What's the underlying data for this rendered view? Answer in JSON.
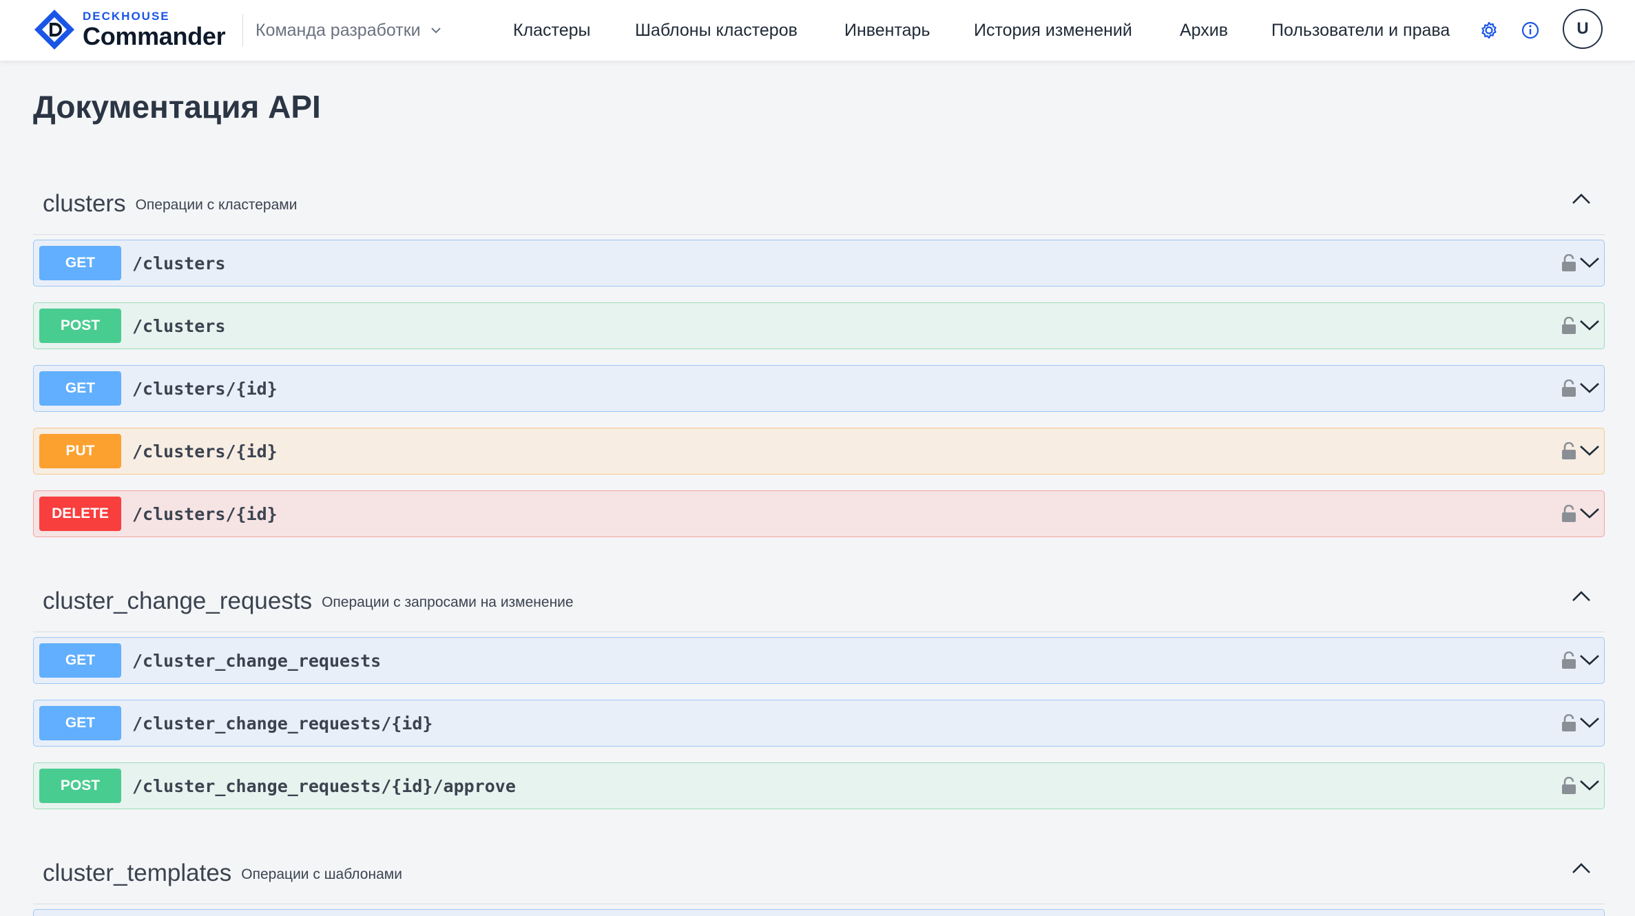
{
  "app": {
    "brand_small": "DECKHOUSE",
    "brand_big": "Commander",
    "team": "Команда разработки"
  },
  "nav": [
    {
      "label": "Кластеры"
    },
    {
      "label": "Шаблоны кластеров"
    },
    {
      "label": "Инвентарь"
    },
    {
      "label": "История изменений"
    },
    {
      "label": "Архив"
    },
    {
      "label": "Пользователи и права"
    }
  ],
  "user": {
    "initial": "U"
  },
  "page": {
    "title": "Документация API"
  },
  "sections": [
    {
      "name": "clusters",
      "description": "Операции с кластерами",
      "operations": [
        {
          "method": "GET",
          "path": "/clusters"
        },
        {
          "method": "POST",
          "path": "/clusters"
        },
        {
          "method": "GET",
          "path": "/clusters/{id}"
        },
        {
          "method": "PUT",
          "path": "/clusters/{id}"
        },
        {
          "method": "DELETE",
          "path": "/clusters/{id}"
        }
      ]
    },
    {
      "name": "cluster_change_requests",
      "description": "Операции с запросами на изменение",
      "operations": [
        {
          "method": "GET",
          "path": "/cluster_change_requests"
        },
        {
          "method": "GET",
          "path": "/cluster_change_requests/{id}"
        },
        {
          "method": "POST",
          "path": "/cluster_change_requests/{id}/approve"
        }
      ]
    },
    {
      "name": "cluster_templates",
      "description": "Операции с шаблонами",
      "operations": []
    }
  ],
  "colors": {
    "brand": "#1a55e6",
    "get_badge": "#61affe",
    "get_bg": "#e9eff8",
    "get_border": "#9cc6f5",
    "post_badge": "#49cc90",
    "post_bg": "#e7f3ee",
    "post_border": "#9fdcbd",
    "put_badge": "#fca130",
    "put_bg": "#f7ede2",
    "put_border": "#f6c98f",
    "delete_badge": "#f93e3e",
    "delete_bg": "#f6e3e3",
    "delete_border": "#f2a3a3"
  },
  "icons": {
    "logo": "deckhouse-logo-icon",
    "team_dropdown": "chevron-down-icon",
    "settings": "gear-icon",
    "info": "info-icon",
    "section_toggle": "chevron-up-icon",
    "lock": "lock-open-icon",
    "expand": "chevron-down-icon"
  }
}
